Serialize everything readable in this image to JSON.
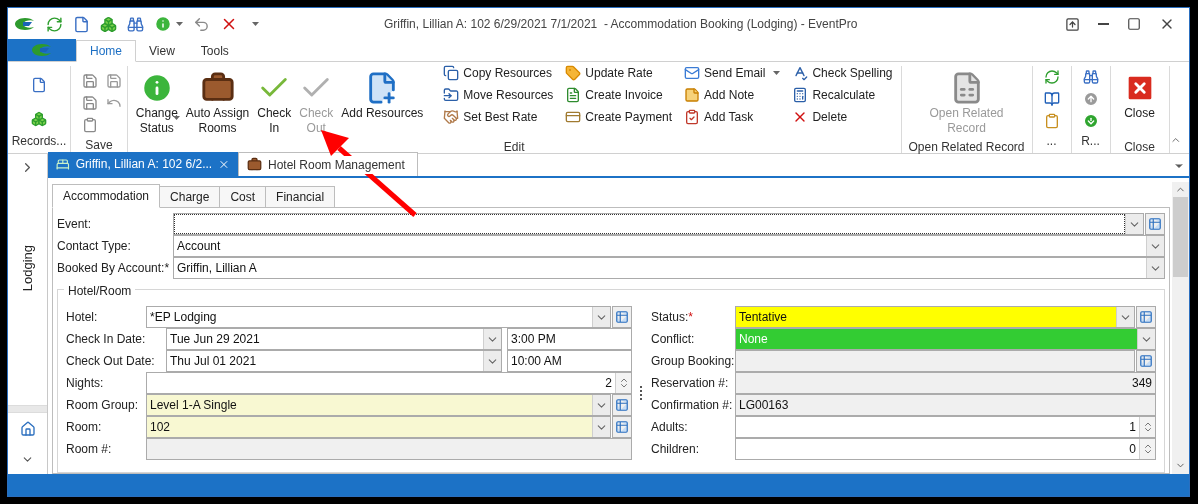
{
  "title_bar": {
    "title": "Griffin, Lillian A: 102 6/29/2021 7/1/2021  - Accommodation Booking (Lodging) - EventPro"
  },
  "ribbon": {
    "tabs": [
      {
        "label": "Home",
        "selected": true
      },
      {
        "label": "View",
        "selected": false
      },
      {
        "label": "Tools",
        "selected": false
      }
    ],
    "groups": [
      {
        "kind": "records",
        "label": "Records..."
      },
      {
        "kind": "save",
        "label": "Save"
      },
      {
        "kind": "edit",
        "label": "Edit",
        "large": [
          {
            "label": "Change\nStatus",
            "dropdown": true,
            "disabled": false
          },
          {
            "label": "Auto Assign\nRooms",
            "dropdown": false,
            "disabled": false
          },
          {
            "label": "Check\nIn",
            "dropdown": false,
            "disabled": false
          },
          {
            "label": "Check\nOut",
            "dropdown": false,
            "disabled": true
          },
          {
            "label": "Add Resources",
            "dropdown": false,
            "disabled": false
          }
        ],
        "small_columns": [
          [
            {
              "label": "Copy Resources",
              "dropdown": false
            },
            {
              "label": "Move Resources",
              "dropdown": false
            },
            {
              "label": "Set Best Rate",
              "dropdown": false
            }
          ],
          [
            {
              "label": "Update Rate",
              "dropdown": false
            },
            {
              "label": "Create Invoice",
              "dropdown": false
            },
            {
              "label": "Create Payment",
              "dropdown": false
            }
          ],
          [
            {
              "label": "Send Email",
              "dropdown": true
            },
            {
              "label": "Add Note",
              "dropdown": false
            },
            {
              "label": "Add Task",
              "dropdown": false
            }
          ],
          [
            {
              "label": "Check Spelling",
              "dropdown": false
            },
            {
              "label": "Recalculate",
              "dropdown": false
            },
            {
              "label": "Delete",
              "dropdown": false
            }
          ]
        ]
      },
      {
        "kind": "related",
        "label": "Open Related Record",
        "large": [
          {
            "label": "Open Related\nRecord",
            "dropdown": false,
            "disabled": true
          }
        ]
      },
      {
        "kind": "more",
        "label": "..."
      },
      {
        "kind": "nav",
        "label": "R..."
      },
      {
        "kind": "close",
        "label": "Close",
        "large": [
          {
            "label": "Close",
            "dropdown": false,
            "disabled": false
          }
        ]
      }
    ]
  },
  "doc_tabs": [
    {
      "label": "Griffin, Lillian A: 102 6/2...",
      "selected": true
    },
    {
      "label": "Hotel Room Management",
      "selected": false
    }
  ],
  "side_panel": {
    "label": "Lodging"
  },
  "form": {
    "tabs": [
      {
        "label": "Accommodation",
        "selected": true
      },
      {
        "label": "Charge",
        "selected": false
      },
      {
        "label": "Cost",
        "selected": false
      },
      {
        "label": "Financial",
        "selected": false
      }
    ],
    "top_fields": [
      {
        "label": "Event:",
        "kind": "combo",
        "add_button": true,
        "focused": true
      },
      {
        "label": "Contact Type:",
        "kind": "combo",
        "value": "Account",
        "add_button": false,
        "focused": false
      },
      {
        "label": "Booked By Account:*",
        "kind": "combo",
        "value": "Griffin, Lillian A",
        "add_button": false,
        "focused": false
      }
    ],
    "group": {
      "title": "Hotel/Room",
      "left": [
        {
          "label": "Hotel:",
          "kind": "combo",
          "value": "*EP Lodging",
          "add_button": true
        },
        {
          "label": "Check In Date:",
          "kind": "date",
          "value": "Tue Jun 29 2021",
          "time": "3:00 PM"
        },
        {
          "label": "Check Out Date:",
          "kind": "date",
          "value": "Thu Jul 01 2021",
          "time": "10:00 AM"
        },
        {
          "label": "Nights:",
          "kind": "number",
          "value": "2",
          "spinner": true
        },
        {
          "label": "Room Group:",
          "kind": "combo",
          "value": "Level 1-A Single",
          "add_button": true,
          "color": "#f8f8d2"
        },
        {
          "label": "Room:",
          "kind": "combo",
          "value": "102",
          "add_button": true,
          "color": "#f8f8d2"
        },
        {
          "label": "Room #:",
          "kind": "text",
          "readonly": true
        }
      ],
      "right": [
        {
          "label": "Status:",
          "required_mark": "*",
          "kind": "combo",
          "value": "Tentative",
          "add_button": true,
          "color": "#ffff00"
        },
        {
          "label": "Conflict:",
          "kind": "combo",
          "value": "None",
          "color": "#33cc33"
        },
        {
          "label": "Group Booking:",
          "kind": "text",
          "readonly": true,
          "add_button": true
        },
        {
          "label": "Reservation #:",
          "kind": "number",
          "value": "349",
          "readonly": true
        },
        {
          "label": "Confirmation #:",
          "kind": "text",
          "value": "LG00163",
          "readonly": true
        },
        {
          "label": "Adults:",
          "kind": "number",
          "value": "1",
          "spinner": true
        },
        {
          "label": "Children:",
          "kind": "number",
          "value": "0",
          "spinner": true
        }
      ]
    }
  }
}
